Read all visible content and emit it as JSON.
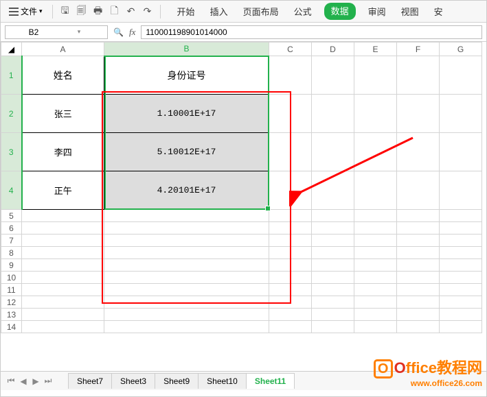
{
  "toolbar": {
    "file_label": "文件",
    "tabs": [
      "开始",
      "插入",
      "页面布局",
      "公式",
      "数据",
      "审阅",
      "视图",
      "安"
    ]
  },
  "formula": {
    "name_box": "B2",
    "fx_label": "fx",
    "value": "110001198901014000"
  },
  "columns": [
    "A",
    "B",
    "C",
    "D",
    "E",
    "F",
    "G"
  ],
  "table": {
    "headers": {
      "A": "姓名",
      "B": "身份证号"
    },
    "rows": [
      {
        "name": "张三",
        "id": "1.10001E+17"
      },
      {
        "name": "李四",
        "id": "5.10012E+17"
      },
      {
        "name": "正午",
        "id": "4.20101E+17"
      }
    ]
  },
  "sheets": [
    "Sheet7",
    "Sheet3",
    "Sheet9",
    "Sheet10",
    "Sheet11"
  ],
  "active_sheet": "Sheet11",
  "watermark": {
    "line1_a": "O",
    "line1_b": "ffice教程网",
    "line2": "www.office26.com"
  }
}
